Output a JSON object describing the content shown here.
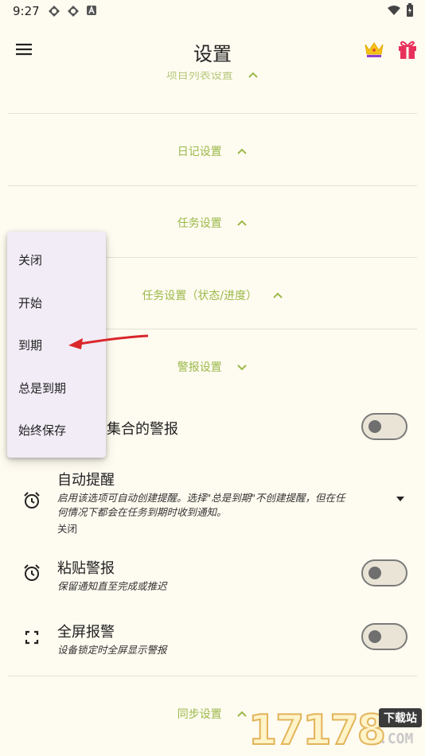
{
  "status": {
    "time": "9:27"
  },
  "app": {
    "title": "设置"
  },
  "sections": {
    "project_list": "项目列表设置",
    "diary": "日记设置",
    "task": "任务设置",
    "task_status": "任务设置（状态/进度）",
    "alarm": "警报设置",
    "sync": "同步设置"
  },
  "rows": {
    "collection_alarm_title": "续集合的警报",
    "auto_remind_title": "自动提醒",
    "auto_remind_sub_1": "启用该选项可自动创建提醒。选择\"总是到期\"不创建提醒，但在任",
    "auto_remind_sub_2": "何情况下都会在任务到期时收到通知。",
    "auto_remind_value": "关闭",
    "sticky_title": "粘贴警报",
    "sticky_sub": "保留通知直至完成或推迟",
    "fullscreen_title": "全屏报警",
    "fullscreen_sub": "设备锁定时全屏显示警报"
  },
  "popup": {
    "items": [
      "关闭",
      "开始",
      "到期",
      "总是到期",
      "始终保存"
    ]
  },
  "icons": {
    "menu": "hamburger-menu-icon",
    "crown": "crown-icon",
    "gift": "gift-icon",
    "alarm": "alarm-clock-icon",
    "fullscreen": "fullscreen-icon",
    "chevron_up": "chevron-up-icon",
    "chevron_down": "chevron-down-icon"
  },
  "watermark": {
    "digits": "17178",
    "tag": "下载站",
    "domain": ".COM"
  },
  "colors": {
    "accent": "#9bb94a",
    "background": "#fefbf0",
    "popup": "#f1ecf6",
    "annotation": "#d9272b"
  }
}
